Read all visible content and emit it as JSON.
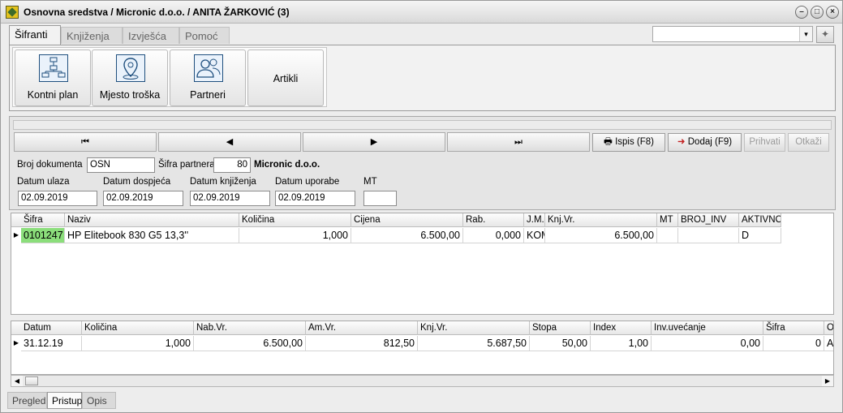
{
  "window": {
    "title": "Osnovna sredstva / Micronic d.o.o. / ANITA ŽARKOVIĆ (3)",
    "min_glyph": "–",
    "max_glyph": "□",
    "close_glyph": "×"
  },
  "menu_tabs": [
    "Šifranti",
    "Knjiženja",
    "Izvješća",
    "Pomoć"
  ],
  "search": {
    "value": "",
    "dropdown_glyph": "▾",
    "pin_glyph": "✦"
  },
  "ribbon": {
    "buttons": [
      {
        "label": "Kontni plan",
        "icon": "hierarchy-icon"
      },
      {
        "label": "Mjesto troška",
        "icon": "location-pin-icon"
      },
      {
        "label": "Partneri",
        "icon": "people-icon"
      },
      {
        "label": "Artikli",
        "icon": ""
      }
    ]
  },
  "nav": {
    "first": "⏮",
    "prev": "◀",
    "next": "▶",
    "last": "⏭"
  },
  "actions": {
    "print": "Ispis (F8)",
    "add": "Dodaj (F9)",
    "accept": "Prihvati",
    "cancel": "Otkaži"
  },
  "form": {
    "broj_dokumenta_label": "Broj dokumenta",
    "broj_dokumenta": "OSN",
    "sifra_partnera_label": "Šifra partnera",
    "sifra_partnera": "80",
    "partner_name": "Micronic d.o.o.",
    "datum_ulaza_label": "Datum ulaza",
    "datum_ulaza": "02.09.2019",
    "datum_dospijeca_label": "Datum dospjeća",
    "datum_dospijeca": "02.09.2019",
    "datum_knjizenja_label": "Datum knjiženja",
    "datum_knjizenja": "02.09.2019",
    "datum_uporabe_label": "Datum uporabe",
    "datum_uporabe": "02.09.2019",
    "mt_label": "MT",
    "mt": ""
  },
  "items_grid": {
    "columns": [
      "Šifra",
      "Naziv",
      "Količina",
      "Cijena",
      "Rab.",
      "J.M.",
      "Knj.Vr.",
      "MT",
      "BROJ_INV",
      "AKTIVNO"
    ],
    "rows": [
      [
        "0101247",
        "HP Elitebook 830 G5 13,3''",
        "1,000",
        "6.500,00",
        "0,000",
        "KOM",
        "6.500,00",
        "",
        "",
        "D"
      ]
    ]
  },
  "amort_grid": {
    "columns": [
      "Datum",
      "Količina",
      "Nab.Vr.",
      "Am.Vr.",
      "Knj.Vr.",
      "Stopa",
      "Index",
      "Inv.uvećanje",
      "Šifra",
      "O"
    ],
    "rows": [
      [
        "31.12.19",
        "1,000",
        "6.500,00",
        "812,50",
        "5.687,50",
        "50,00",
        "1,00",
        "0,00",
        "0",
        "A"
      ]
    ]
  },
  "bottom_tabs": [
    "Pregled",
    "Pristup",
    "Opis"
  ]
}
